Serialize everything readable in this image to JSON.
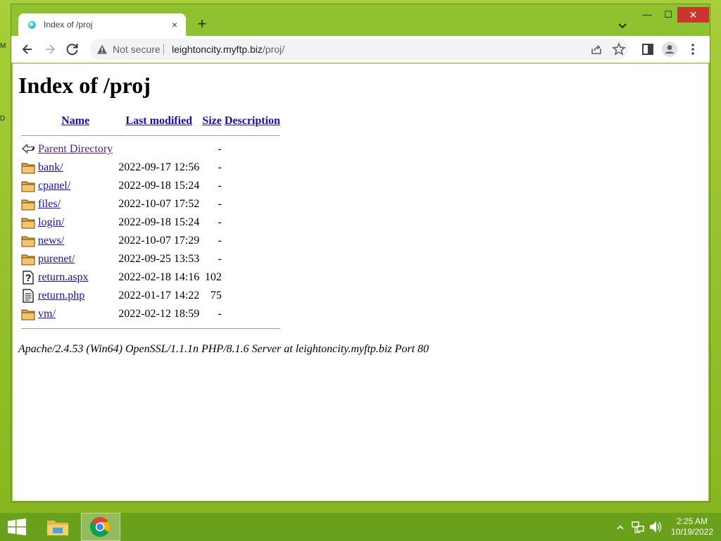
{
  "desktop": {
    "edge_letters": [
      "M",
      "D"
    ]
  },
  "browser": {
    "tab": {
      "title": "Index of /proj",
      "close_glyph": "×"
    },
    "new_tab_glyph": "+",
    "window_controls": {
      "minimize": "—",
      "maximize": "☐",
      "close": "✕"
    },
    "omnibox": {
      "security_label": "Not secure",
      "url_host": "leightoncity.myftp.biz",
      "url_path": "/proj/"
    },
    "icons": [
      "back-icon",
      "forward-icon",
      "reload-icon",
      "warning-icon",
      "share-icon",
      "star-icon",
      "side-panel-icon",
      "profile-icon",
      "menu-icon",
      "tab-search-icon"
    ]
  },
  "page": {
    "heading": "Index of /proj",
    "columns": {
      "name": "Name",
      "last_modified": "Last modified",
      "size": "Size",
      "description": "Description"
    },
    "rows": [
      {
        "icon": "back-icon",
        "name": "Parent Directory",
        "modified": "",
        "size": "-",
        "visited": true
      },
      {
        "icon": "folder-icon",
        "name": "bank/",
        "modified": "2022-09-17 12:56",
        "size": "-",
        "visited": false
      },
      {
        "icon": "folder-icon",
        "name": "cpanel/",
        "modified": "2022-09-18 15:24",
        "size": "-",
        "visited": false
      },
      {
        "icon": "folder-icon",
        "name": "files/",
        "modified": "2022-10-07 17:52",
        "size": "-",
        "visited": false
      },
      {
        "icon": "folder-icon",
        "name": "login/",
        "modified": "2022-09-18 15:24",
        "size": "-",
        "visited": false
      },
      {
        "icon": "folder-icon",
        "name": "news/",
        "modified": "2022-10-07 17:29",
        "size": "-",
        "visited": false
      },
      {
        "icon": "folder-icon",
        "name": "purenet/",
        "modified": "2022-09-25 13:53",
        "size": "-",
        "visited": false
      },
      {
        "icon": "unknown-file-icon",
        "name": "return.aspx",
        "modified": "2022-02-18 14:16",
        "size": "102",
        "visited": false
      },
      {
        "icon": "text-file-icon",
        "name": "return.php",
        "modified": "2022-01-17 14:22",
        "size": "75",
        "visited": false
      },
      {
        "icon": "folder-icon",
        "name": "vm/",
        "modified": "2022-02-12 18:59",
        "size": "-",
        "visited": false
      }
    ],
    "server_signature": "Apache/2.4.53 (Win64) OpenSSL/1.1.1n PHP/8.1.6 Server at leightoncity.myftp.biz Port 80"
  },
  "taskbar": {
    "apps": [
      "file-explorer-icon",
      "chrome-icon"
    ],
    "active_app": "chrome-icon",
    "tray_icons": [
      "show-hidden-icons-chevron",
      "network-icon",
      "volume-icon"
    ],
    "clock": {
      "time": "2:25 AM",
      "date": "10/19/2022"
    }
  }
}
